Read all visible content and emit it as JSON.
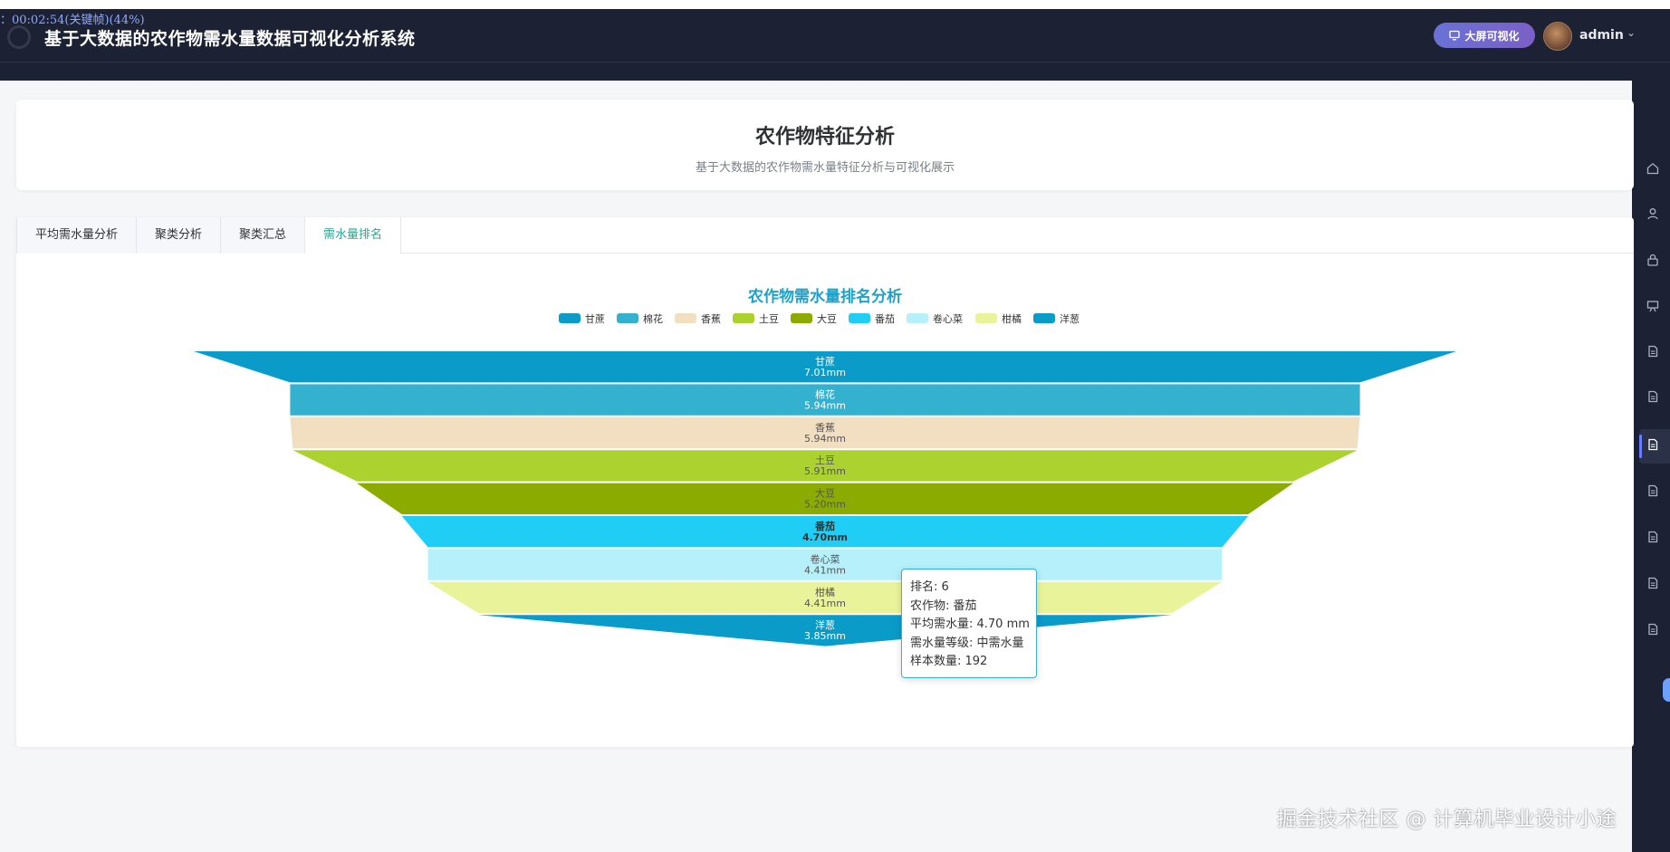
{
  "header": {
    "timer_text": "：00:02:54(关键帧)(44%)",
    "app_title": "基于大数据的农作物需水量数据可视化分析系统",
    "bigscreen_button": "大屏可视化",
    "user_name": "admin"
  },
  "hero": {
    "title": "农作物特征分析",
    "subtitle": "基于大数据的农作物需水量特征分析与可视化展示"
  },
  "tabs": [
    {
      "label": "平均需水量分析",
      "active": false
    },
    {
      "label": "聚类分析",
      "active": false
    },
    {
      "label": "聚类汇总",
      "active": false
    },
    {
      "label": "需水量排名",
      "active": true
    }
  ],
  "chart_data": {
    "type": "funnel",
    "title": "农作物需水量排名分析",
    "legend_position": "top-center",
    "unit": "mm",
    "categories": [
      "甘蔗",
      "棉花",
      "香蕉",
      "土豆",
      "大豆",
      "番茄",
      "卷心菜",
      "柑橘",
      "洋葱"
    ],
    "values": [
      7.01,
      5.94,
      5.94,
      5.91,
      5.2,
      4.7,
      4.41,
      4.41,
      3.85
    ],
    "value_labels": [
      "7.01mm",
      "5.94mm",
      "5.94mm",
      "5.91mm",
      "5.20mm",
      "4.70mm",
      "4.41mm",
      "4.41mm",
      "3.85mm"
    ],
    "colors": [
      "#0b9bc9",
      "#33b1cf",
      "#f2dfc2",
      "#abd22f",
      "#8bab00",
      "#1fcdf5",
      "#b5f0fb",
      "#e9f49a",
      "#0b9bc9"
    ],
    "highlighted": "番茄"
  },
  "tooltip": {
    "lines": [
      "排名: 6",
      "农作物: 番茄",
      "平均需水量: 4.70 mm",
      "需水量等级: 中需水量",
      "样本数量: 192"
    ]
  },
  "watermark": "掘金技术社区 @ 计算机毕业设计小途",
  "right_rail": {
    "icons": [
      "home-icon",
      "user-icon",
      "lock-icon",
      "presentation-icon",
      "document-icon",
      "document-icon",
      "document-icon",
      "document-icon",
      "document-icon",
      "document-icon",
      "document-icon"
    ],
    "active_index": 6,
    "accent_color": "#6b7cff"
  }
}
